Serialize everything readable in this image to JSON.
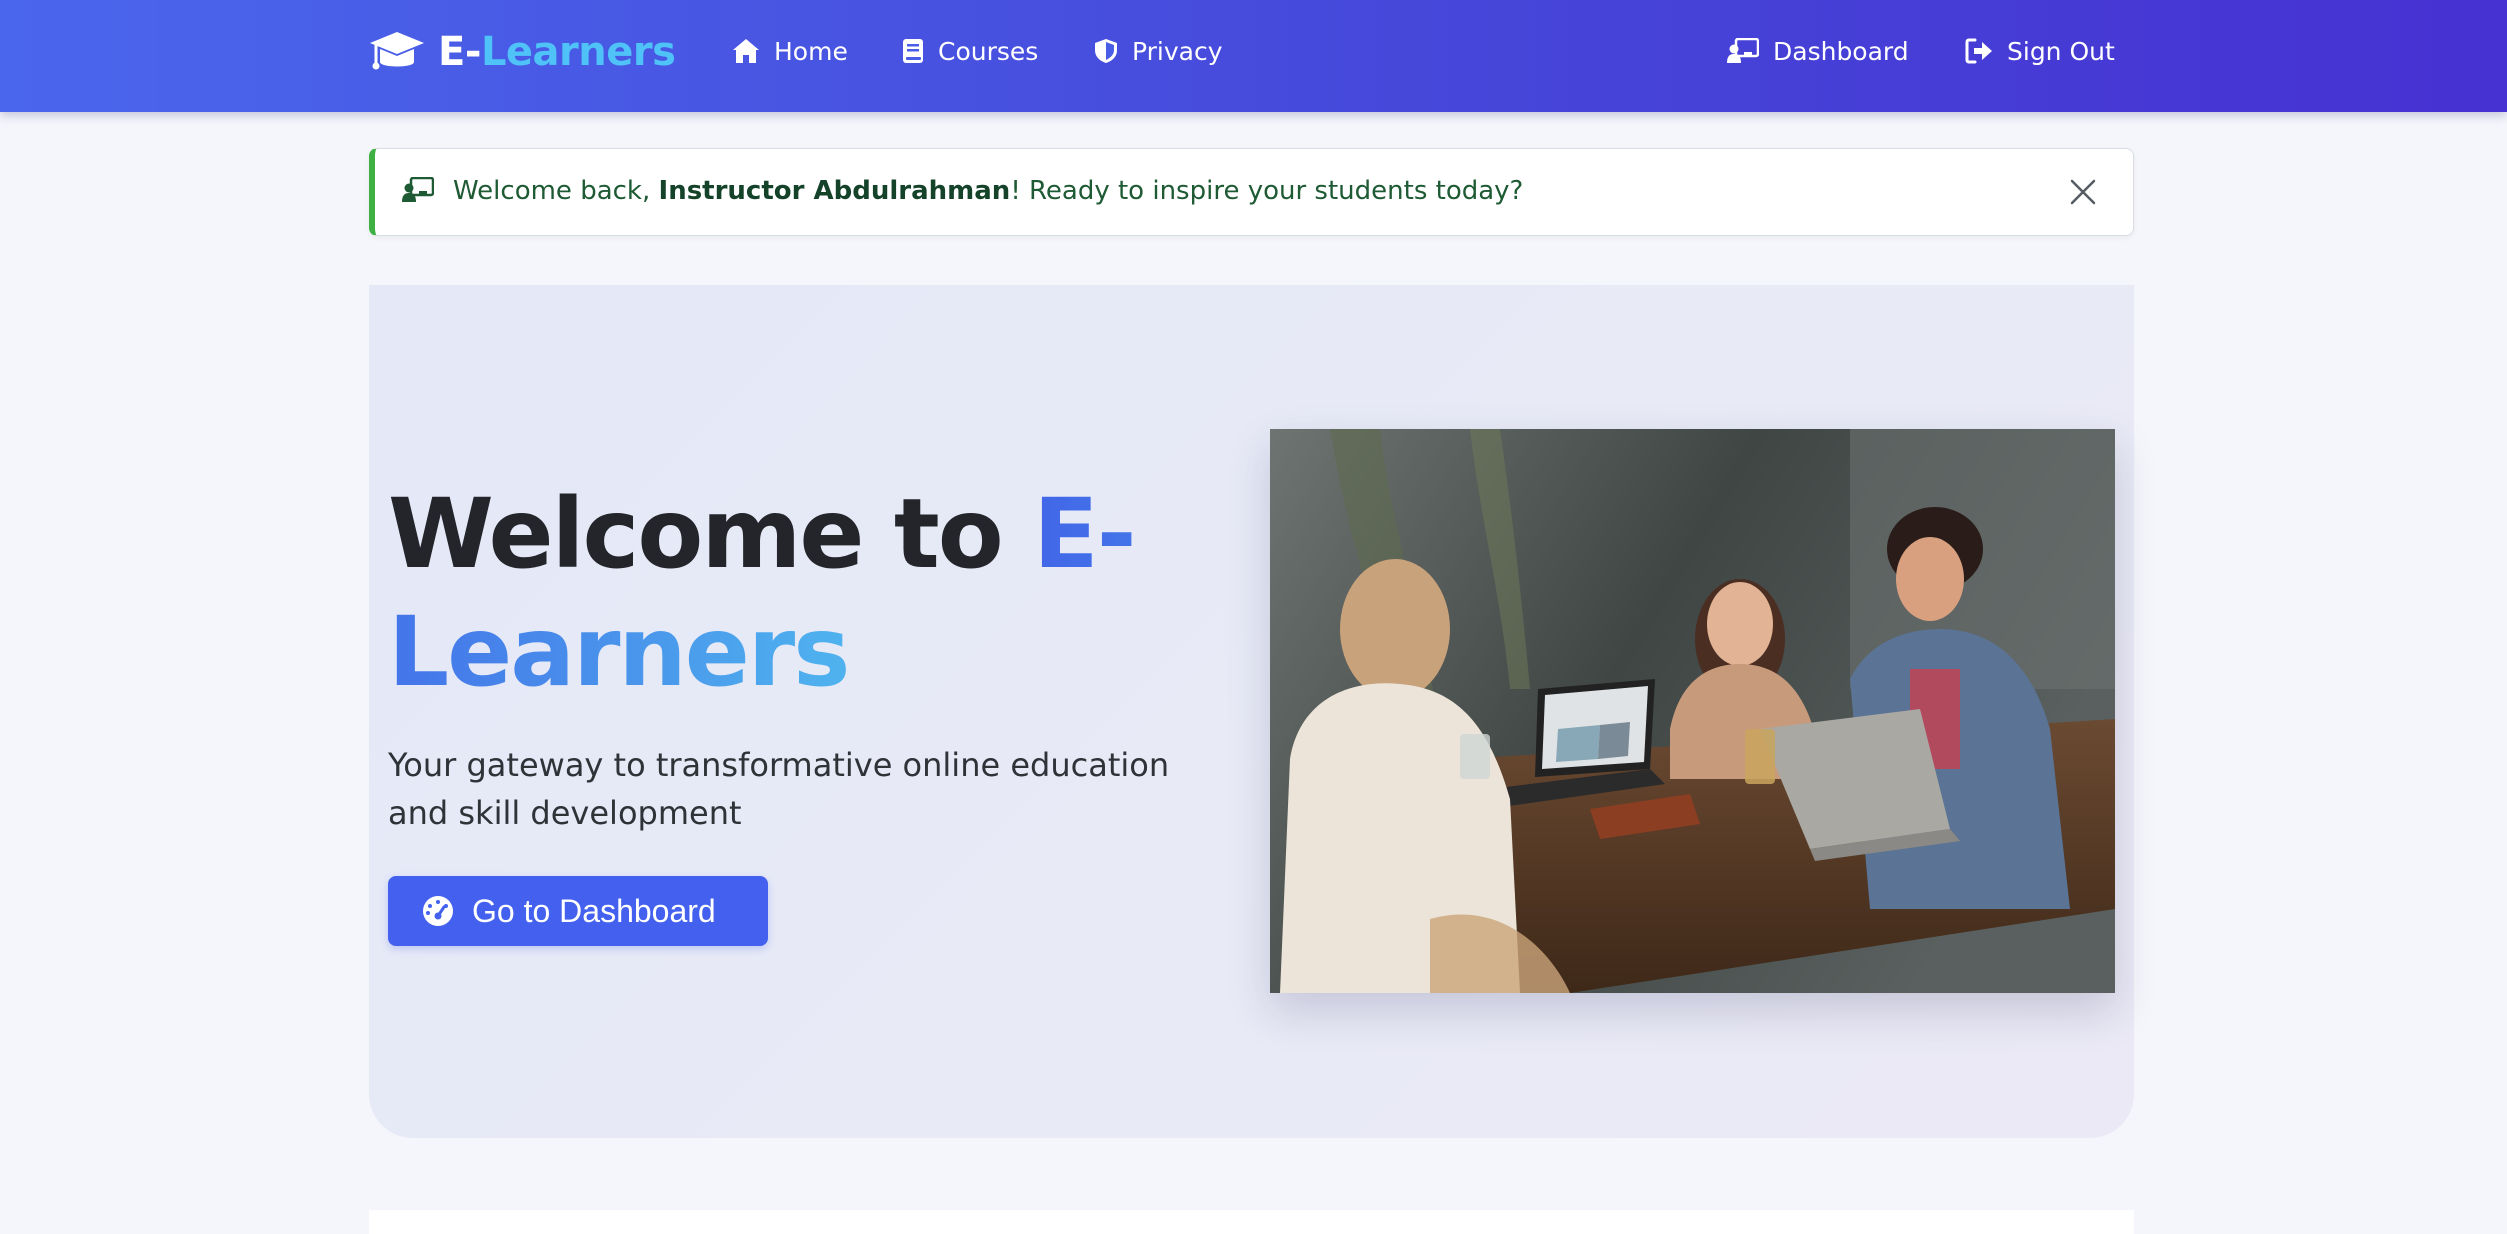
{
  "navbar": {
    "brand": {
      "part1": "E-",
      "part2": "Learners"
    },
    "left_items": [
      {
        "label": "Home",
        "icon": "home-icon"
      },
      {
        "label": "Courses",
        "icon": "book-icon"
      },
      {
        "label": "Privacy",
        "icon": "shield-icon"
      }
    ],
    "right_items": [
      {
        "label": "Dashboard",
        "icon": "chalkboard-teacher-icon"
      },
      {
        "label": "Sign Out",
        "icon": "sign-out-icon"
      }
    ]
  },
  "alert": {
    "prefix": "Welcome back, ",
    "name": "Instructor Abdulrahman",
    "suffix": "! Ready to inspire your students today?",
    "icon": "chalkboard-teacher-icon",
    "close_icon": "close-icon"
  },
  "hero": {
    "title_part1": "Welcome to ",
    "title_part2": "E-Learners",
    "subtitle": "Your gateway to transformative online education and skill development",
    "button_label": "Go to Dashboard",
    "button_icon": "tachometer-icon"
  },
  "colors": {
    "navbar_start": "#4a66ec",
    "navbar_end": "#4631d2",
    "brand_accent": "#4fc3f7",
    "primary_button": "#4361ee",
    "alert_success": "#3fb043",
    "title_gradient_start": "#4166e8",
    "title_gradient_end": "#4fb3ee"
  }
}
